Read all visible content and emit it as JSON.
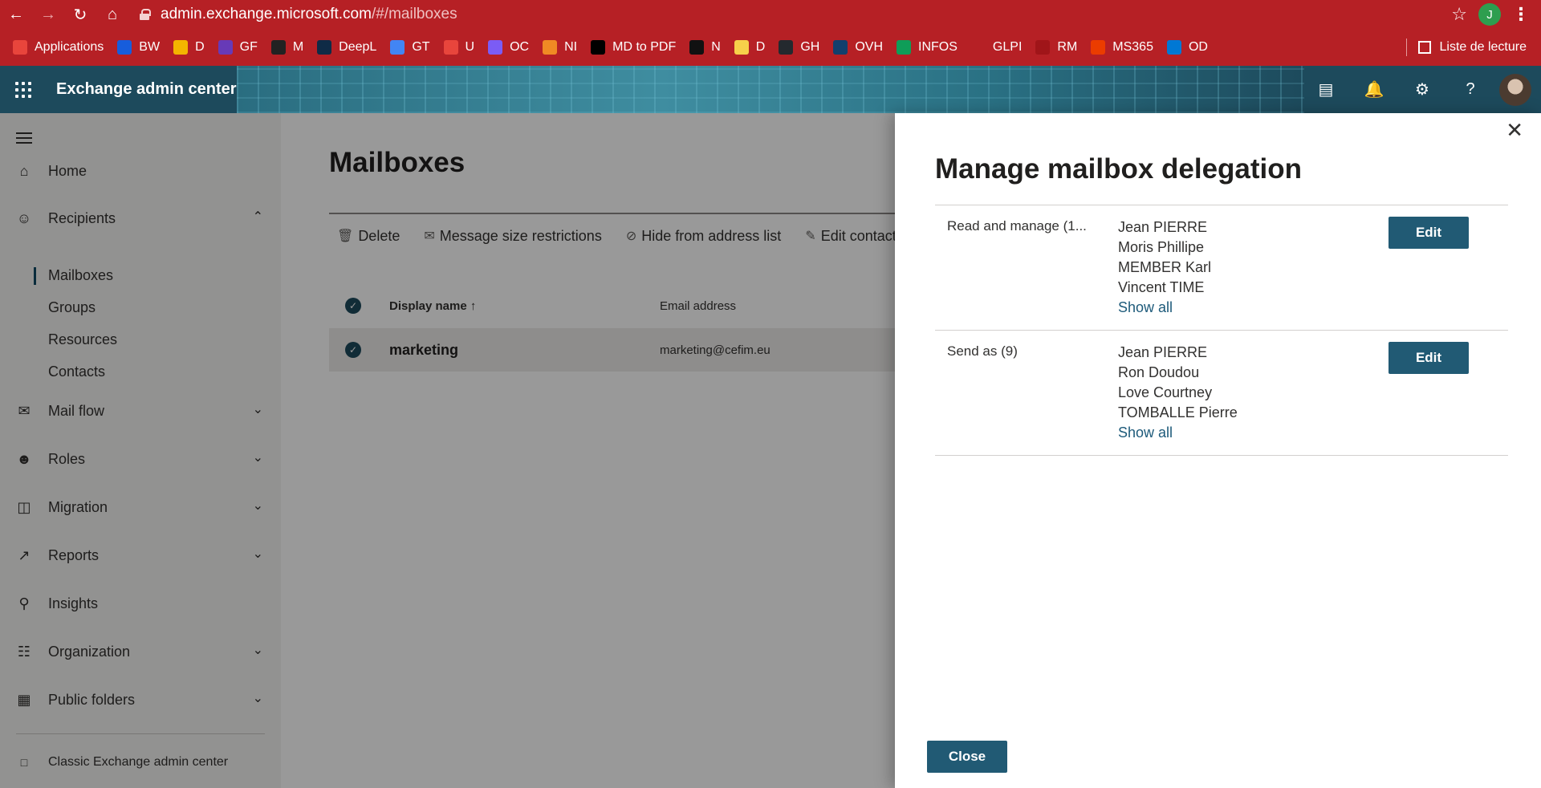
{
  "browser": {
    "url_host": "admin.exchange.microsoft.com",
    "url_path": "/#/mailboxes",
    "profile_initial": "J",
    "bookmarks": [
      {
        "label": "Applications",
        "icon": "apps-grid-icon",
        "color": "#e8453c"
      },
      {
        "label": "BW",
        "icon": "bitwarden-icon",
        "color": "#175ddc"
      },
      {
        "label": "D",
        "icon": "drive-icon",
        "color": "#f4b400"
      },
      {
        "label": "GF",
        "icon": "forms-icon",
        "color": "#673ab7"
      },
      {
        "label": "M",
        "icon": "m-icon",
        "color": "#222222"
      },
      {
        "label": "DeepL",
        "icon": "deepl-icon",
        "color": "#0f2b46"
      },
      {
        "label": "GT",
        "icon": "translate-icon",
        "color": "#4285f4"
      },
      {
        "label": "U",
        "icon": "u-icon",
        "color": "#e8453c"
      },
      {
        "label": "OC",
        "icon": "oc-icon",
        "color": "#7b5cf5"
      },
      {
        "label": "NI",
        "icon": "ni-icon",
        "color": "#f08a24"
      },
      {
        "label": "MD to PDF",
        "icon": "md-icon",
        "color": "#000000"
      },
      {
        "label": "N",
        "icon": "n-icon",
        "color": "#111111"
      },
      {
        "label": "D",
        "icon": "note-icon",
        "color": "#f7d04a"
      },
      {
        "label": "GH",
        "icon": "github-icon",
        "color": "#24292e"
      },
      {
        "label": "OVH",
        "icon": "ovh-icon",
        "color": "#123f6d"
      },
      {
        "label": "INFOS",
        "icon": "sheet-icon",
        "color": "#0f9d58"
      },
      {
        "label": "GLPI",
        "icon": "glpi-icon",
        "color": "#b62025"
      },
      {
        "label": "RM",
        "icon": "rm-icon",
        "color": "#a01519"
      },
      {
        "label": "MS365",
        "icon": "ms365-icon",
        "color": "#eb3c00"
      },
      {
        "label": "OD",
        "icon": "onedrive-icon",
        "color": "#0078d4"
      }
    ],
    "reading_list": "Liste de lecture"
  },
  "header": {
    "app_title": "Exchange admin center"
  },
  "nav": {
    "items": {
      "home": "Home",
      "recipients": "Recipients",
      "mailflow": "Mail flow",
      "roles": "Roles",
      "migration": "Migration",
      "reports": "Reports",
      "insights": "Insights",
      "organization": "Organization",
      "publicfolders": "Public folders"
    },
    "sub": {
      "mailboxes": "Mailboxes",
      "groups": "Groups",
      "resources": "Resources",
      "contacts": "Contacts"
    },
    "classic": "Classic Exchange admin center"
  },
  "main": {
    "title": "Mailboxes",
    "toolbar": {
      "delete": "Delete",
      "size": "Message size restrictions",
      "hide": "Hide from address list",
      "edit_contact": "Edit contact in"
    },
    "columns": {
      "display_name": "Display name",
      "email": "Email address"
    },
    "row": {
      "name": "marketing",
      "email": "marketing@cefim.eu"
    }
  },
  "panel": {
    "title": "Manage mailbox delegation",
    "read_manage": {
      "label": "Read and manage (1...",
      "members": [
        "Jean PIERRE",
        "Moris Phillipe",
        "MEMBER Karl",
        "Vincent TIME"
      ],
      "show_all": "Show all",
      "edit": "Edit"
    },
    "send_as": {
      "label": "Send as (9)",
      "members": [
        "Jean PIERRE",
        "Ron Doudou",
        "Love Courtney",
        "TOMBALLE Pierre"
      ],
      "show_all": "Show all",
      "edit": "Edit"
    },
    "close": "Close"
  }
}
